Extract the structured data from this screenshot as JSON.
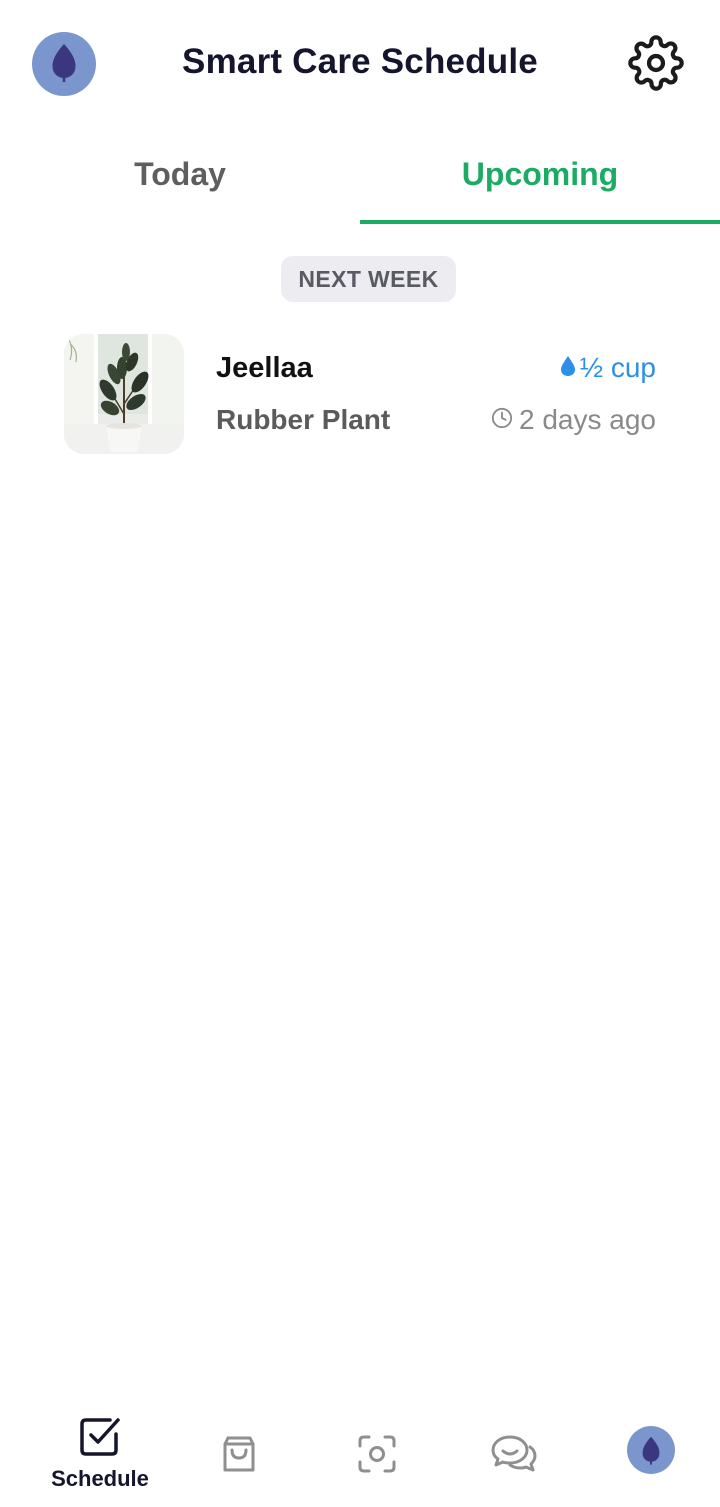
{
  "header": {
    "title": "Smart Care Schedule",
    "avatar_icon": "leaf-icon",
    "settings_icon": "gear-icon"
  },
  "tabs": [
    {
      "label": "Today",
      "active": false
    },
    {
      "label": "Upcoming",
      "active": true
    }
  ],
  "section": {
    "label": "NEXT WEEK"
  },
  "plants": [
    {
      "name": "Jeellaa",
      "species": "Rubber Plant",
      "water_amount": "½ cup",
      "time": "2 days ago",
      "water_icon": "water-drop-icon",
      "time_icon": "clock-icon"
    }
  ],
  "bottom_nav": {
    "items": [
      {
        "label": "Schedule",
        "icon": "checkbox-icon",
        "active": true
      },
      {
        "label": "",
        "icon": "shopping-bag-icon",
        "active": false
      },
      {
        "label": "",
        "icon": "camera-scan-icon",
        "active": false
      },
      {
        "label": "",
        "icon": "chat-bubbles-icon",
        "active": false
      },
      {
        "label": "",
        "icon": "profile-avatar-icon",
        "active": false
      }
    ]
  },
  "colors": {
    "accent_green": "#1cab62",
    "water_blue": "#2e8fe6",
    "avatar_bg": "#7b96cc",
    "leaf": "#3b3680",
    "title": "#15152e"
  }
}
